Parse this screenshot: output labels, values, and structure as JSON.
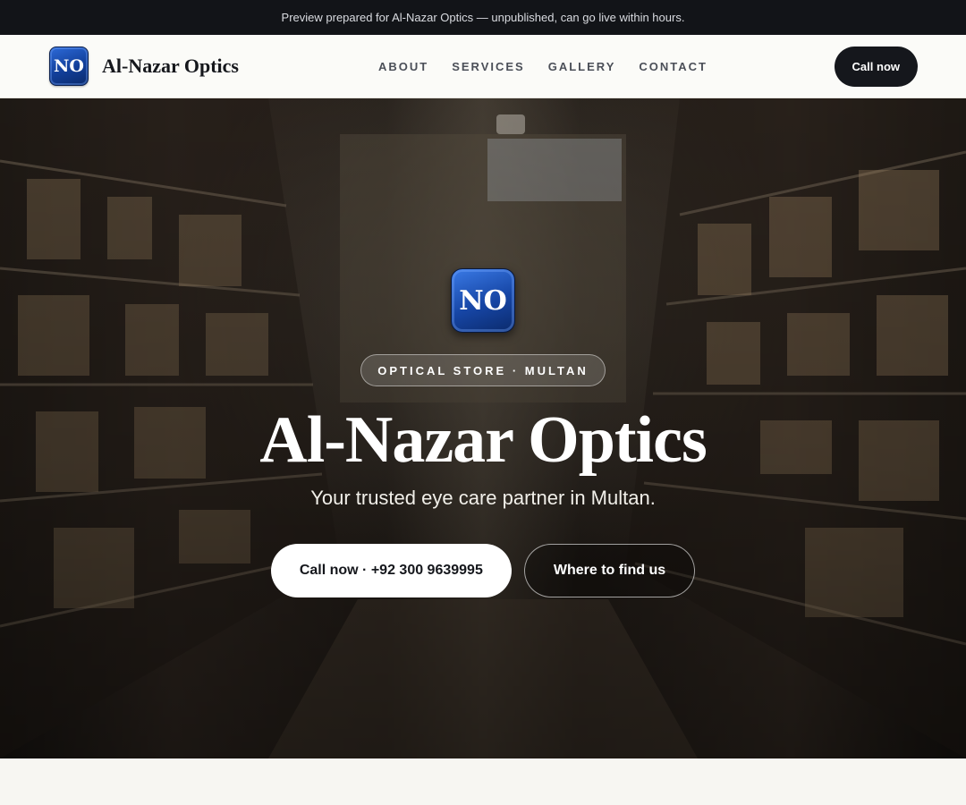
{
  "preview_bar": {
    "text": "Preview prepared for Al-Nazar Optics — unpublished, can go live within hours."
  },
  "header": {
    "logo_text": "NO",
    "brand_name": "Al-Nazar Optics",
    "nav": [
      "ABOUT",
      "SERVICES",
      "GALLERY",
      "CONTACT"
    ],
    "cta_label": "Call now"
  },
  "hero": {
    "background_image": "store-aisle-photo",
    "logo_text": "NO",
    "tag": "OPTICAL STORE · MULTAN",
    "title": "Al-Nazar Optics",
    "subtitle": "Your trusted eye care partner in Multan.",
    "primary_button": "Call now · +92 300 9639995",
    "secondary_button": "Where to find us"
  },
  "colors": {
    "dark": "#15171c",
    "logo_blue": "#1645a4",
    "page_bg": "#f7f6f2"
  }
}
